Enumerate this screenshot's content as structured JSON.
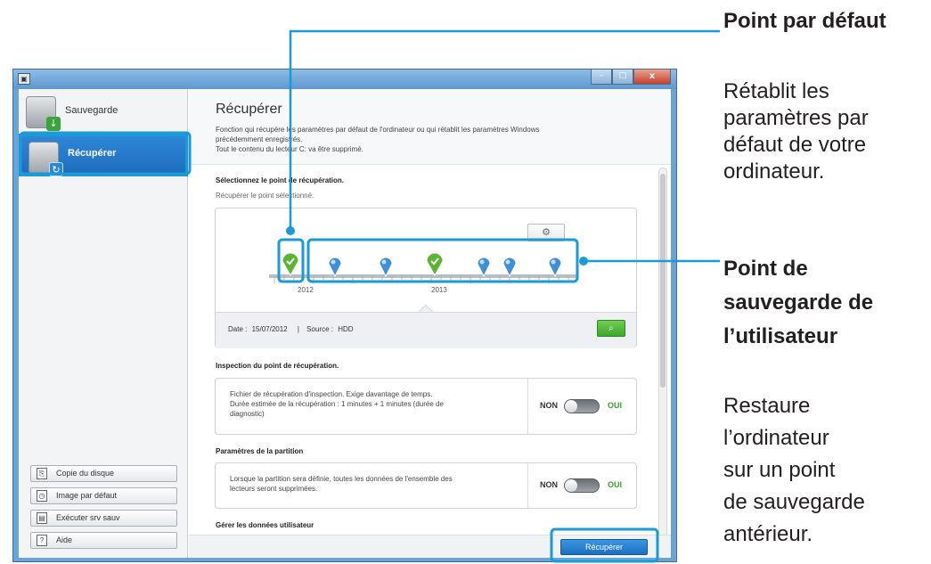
{
  "window": {
    "controls": {
      "minimize": "–",
      "maximize": "□",
      "close": "x"
    }
  },
  "sidebar": {
    "items": [
      {
        "label": "Sauvegarde",
        "icon": "backup-drive-icon",
        "active": false
      },
      {
        "label": "Récupérer",
        "icon": "restore-drive-icon",
        "active": true
      }
    ],
    "buttons": [
      {
        "label": "Copie du disque",
        "icon": "disk-copy-icon"
      },
      {
        "label": "Image par défaut",
        "icon": "default-image-icon"
      },
      {
        "label": "Exécuter srv sauv",
        "icon": "run-server-icon"
      },
      {
        "label": "Aide",
        "icon": "help-icon"
      }
    ]
  },
  "main": {
    "title": "Récupérer",
    "description_lines": [
      "Fonction qui récupère les paramètres par défaut de l'ordinateur ou qui rétablit les paramètres Windows",
      "précédemment enregistrés.",
      "Tout le contenu du lecteur C: va être supprimé."
    ],
    "select_point": {
      "heading": "Sélectionnez le point de récupération.",
      "subtext": "Récupérer le point sélectionné.",
      "years": [
        "2012",
        "2013"
      ],
      "date_label": "Date :",
      "date_value": "15/07/2012",
      "separator": "|",
      "source_label": "Source :",
      "source_value": "HDD"
    },
    "inspection": {
      "heading": "Inspection du point de récupération.",
      "lines": [
        "Fichier de récupération d'inspection. Exige davantage de temps.",
        "Durée estimée de la récupération : 1 minutes + 1 minutes (durée de",
        "diagnostic)"
      ],
      "toggle_off": "NON",
      "toggle_on": "OUI"
    },
    "partition": {
      "heading": "Paramètres de la partition",
      "lines": [
        "Lorsque la partition sera définie, toutes les données de l'ensemble des",
        "lecteurs seront supprimées."
      ],
      "toggle_off": "NON",
      "toggle_on": "OUI"
    },
    "user_data": {
      "heading": "Gérer les données utilisateur"
    },
    "recover_button": "Récupérer"
  },
  "annotations": {
    "default_point": {
      "title": "Point par défaut",
      "body": [
        "Rétablit les",
        "paramètres par",
        "défaut de votre",
        "ordinateur."
      ]
    },
    "user_point": {
      "title": [
        "Point de",
        "sauvegarde de",
        "l’utilisateur"
      ],
      "body": [
        "Restaure",
        "l’ordinateur",
        "sur un point",
        "de sauvegarde",
        "antérieur."
      ]
    }
  },
  "colors": {
    "highlight": "#1a9ad6",
    "accent_blue": "#2f86d0",
    "default_marker": "#5cb531",
    "user_marker": "#3f8fd8"
  }
}
